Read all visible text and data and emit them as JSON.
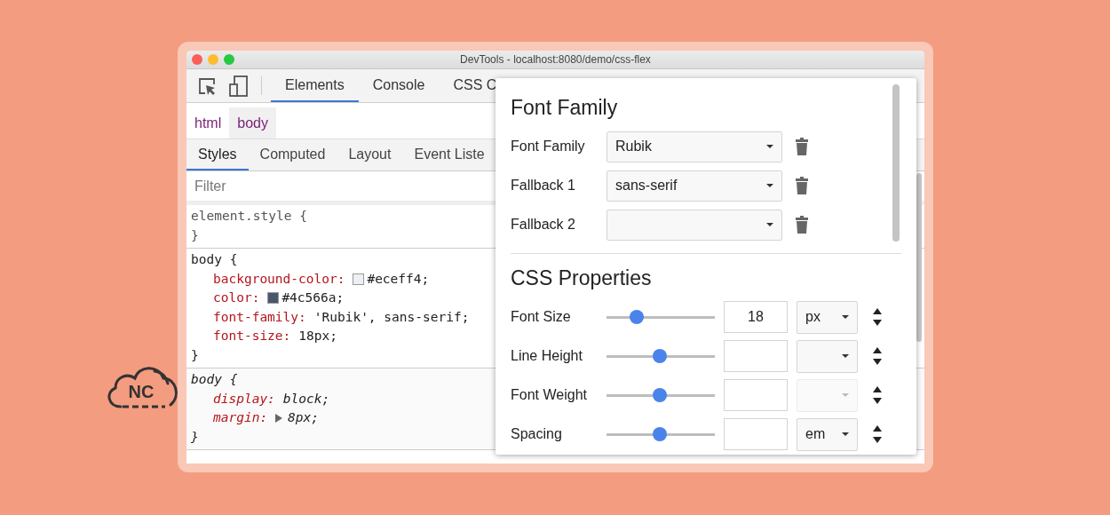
{
  "logo": {
    "text": "NC"
  },
  "window": {
    "title": "DevTools - localhost:8080/demo/css-flex"
  },
  "tabs": [
    {
      "label": "Elements",
      "selected": true
    },
    {
      "label": "Console",
      "selected": false
    },
    {
      "label": "CSS C",
      "selected": false
    }
  ],
  "breadcrumbs": [
    {
      "label": "html",
      "selected": false
    },
    {
      "label": "body",
      "selected": true
    }
  ],
  "style_tabs": [
    {
      "label": "Styles",
      "selected": true
    },
    {
      "label": "Computed",
      "selected": false
    },
    {
      "label": "Layout",
      "selected": false
    },
    {
      "label": "Event Liste",
      "selected": false
    }
  ],
  "filter": {
    "placeholder": "Filter"
  },
  "rules": [
    {
      "kind": "inline",
      "selector": "element.style {",
      "close": "}"
    },
    {
      "kind": "author",
      "selector": "body {",
      "close": "}",
      "declarations": [
        {
          "property": "background-color:",
          "value": "#eceff4;",
          "color": "#eceff4"
        },
        {
          "property": "color:",
          "value": "#4c566a;",
          "color": "#4c566a"
        },
        {
          "property": "font-family:",
          "value": "'Rubik', sans-serif;"
        },
        {
          "property": "font-size:",
          "value": "18px;"
        }
      ]
    },
    {
      "kind": "user_agent",
      "selector": "body {",
      "close": "}",
      "declarations": [
        {
          "property": "display:",
          "value": "block;"
        },
        {
          "property": "margin:",
          "value": "8px;",
          "expandable": true
        }
      ]
    }
  ],
  "popup": {
    "font_family": {
      "heading": "Font Family",
      "rows": [
        {
          "label": "Font Family",
          "value": "Rubik"
        },
        {
          "label": "Fallback 1",
          "value": "sans-serif"
        },
        {
          "label": "Fallback 2"
        }
      ]
    },
    "css_properties": {
      "heading": "CSS Properties",
      "rows": [
        {
          "label": "Font Size",
          "level": 0.28,
          "value": "18",
          "unit": "px",
          "disabled": false
        },
        {
          "label": "Line Height",
          "level": 0.49,
          "disabled": false
        },
        {
          "label": "Font Weight",
          "level": 0.49,
          "disabled": true
        },
        {
          "label": "Spacing",
          "level": 0.49,
          "unit": "em",
          "disabled": false
        }
      ]
    }
  }
}
